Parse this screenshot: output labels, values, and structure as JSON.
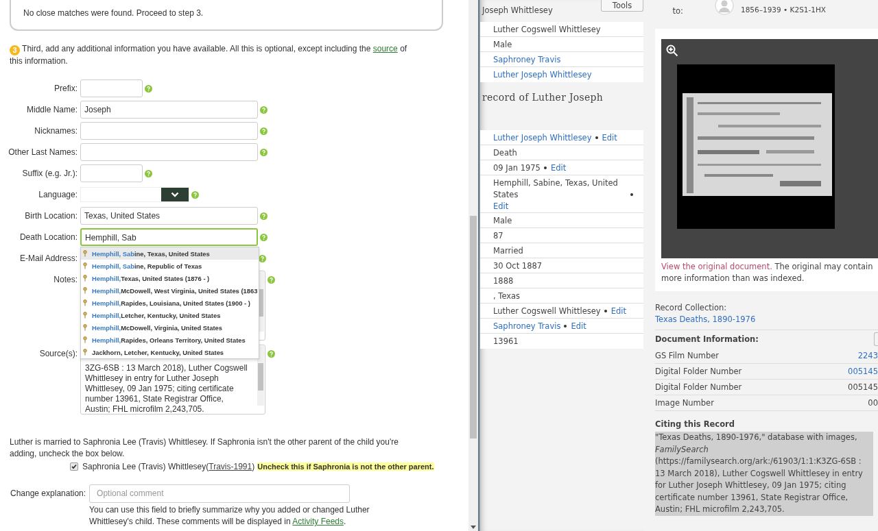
{
  "form": {
    "match_notice": "No close matches were found. Proceed to step 3.",
    "step": {
      "number": "3",
      "before": "Third, add any additional information you have available. All this is optional, except including the",
      "link": "source",
      "after": "of this information."
    },
    "fields": [
      {
        "label": "Prefix:",
        "kind": "short_text"
      },
      {
        "label": "Middle Name:",
        "kind": "text",
        "value": "Joseph"
      },
      {
        "label": "Nicknames:",
        "kind": "text"
      },
      {
        "label": "Other Last Names:",
        "kind": "text"
      },
      {
        "label": "Suffix (e.g. Jr.):",
        "kind": "short_text"
      },
      {
        "label": "Language:",
        "kind": "select"
      },
      {
        "label": "Birth Location:",
        "kind": "text",
        "value": "Texas, United States"
      },
      {
        "label": "Death Location:",
        "kind": "text",
        "value": "Hemphill, Sab",
        "focused": true
      },
      {
        "label": "E-Mail Address:",
        "kind": "covered"
      },
      {
        "label": "Notes:",
        "kind": "textarea"
      },
      {
        "label": "Source(s):",
        "kind": "textarea",
        "value": "3ZG-6SB : 13 March 2018), Luther Cogswell Whittlesey in entry for Luther Joseph Whittlesey, 09 Jan 1975; citing certificate number 13961, State Registrar Office, Austin; FHL microfilm 2,243,705."
      }
    ],
    "suggestions": [
      {
        "match": "Hemphill, Sab",
        "rest": "ine, Texas, United States",
        "selected": true
      },
      {
        "match": "Hemphill, Sab",
        "rest": "ine, Republic of Texas",
        "selected": false
      },
      {
        "match": "Hemphill,",
        "rest": "Texas, United States (1876 - )",
        "selected": false
      },
      {
        "match": "Hemphill,",
        "rest": "McDowell, West Virginia, United States (1863",
        "selected": false
      },
      {
        "match": "Hemphill,",
        "rest": "Rapides, Louisiana, United States (1900 - )",
        "selected": false
      },
      {
        "match": "Hemphill,",
        "rest": "Letcher, Kentucky, United States",
        "selected": false
      },
      {
        "match": "Hemphill,",
        "rest": "McDowell, Virginia, United States",
        "selected": false
      },
      {
        "match": "Hemphill,",
        "rest": "Rapides, Orleans Territory, United States",
        "selected": false
      },
      {
        "rest": "Jackhorn, Letcher, Kentucky, United States",
        "selected": false
      }
    ],
    "spouse_note": "Luther is married to Saphronia Lee (Travis) Whittlesey. If Saphronia isn't the other parent of the child you're adding, uncheck the box below.",
    "spouse_option": {
      "checked": true,
      "name": "Saphronia Lee (Travis) Whittlesey(",
      "id": "Travis-1991",
      "after": ")",
      "warning": "Uncheck this if Saphronia is not the other parent."
    },
    "change_explanation": {
      "label": "Change explanation:",
      "placeholder": "Optional comment",
      "help_before": "You can use this field to briefly summarize why you added or changed Luther Whittlesey's child. These comments will be displayed in",
      "help_link": "Activity Feeds",
      "help_after": "."
    }
  },
  "record": {
    "header_name": "Joseph Whittlesey",
    "tools_button": "Tools",
    "top_rows": [
      {
        "text": "Luther Cogswell Whittlesey",
        "link": false
      },
      {
        "text": "Male",
        "link": false
      },
      {
        "text": "Saphroney Travis",
        "link": true
      },
      {
        "text": "Luther Joseph Whittlesey",
        "link": true
      }
    ],
    "section_title": "record of Luther Joseph",
    "rows": [
      {
        "text": "Luther Joseph Whittlesey",
        "link": true,
        "edit": "Edit"
      },
      {
        "text": "Death",
        "link": false
      },
      {
        "text": "09 Jan 1975",
        "link": false,
        "edit": "Edit"
      },
      {
        "text": "Hemphill, Sabine, Texas, United States",
        "link": false,
        "edit": "Edit"
      },
      {
        "text": "Male",
        "link": false
      },
      {
        "text": "87",
        "link": false
      },
      {
        "text": "Married",
        "link": false
      },
      {
        "text": "30 Oct 1887",
        "link": false
      },
      {
        "text": "1888",
        "link": false
      },
      {
        "text": ", Texas",
        "link": false
      },
      {
        "text": "Luther Cogswell Whittlesey",
        "link": false,
        "edit": "Edit"
      },
      {
        "text": "Saphroney Travis",
        "link": true,
        "edit": "Edit"
      },
      {
        "text": "13961",
        "link": false
      }
    ],
    "attached_label": "to:",
    "attached_meta": "1856–1939 • K2S1-1HX",
    "view_link": "View the original document.",
    "view_note": "The original may contain more information than was indexed.",
    "collection_label": "Record Collection:",
    "collection_link": "Texas Deaths, 1890-1976",
    "doc_title": "Document Information:",
    "doc_rows": [
      {
        "label": "GS Film Number",
        "value": "2243",
        "link": true
      },
      {
        "label": "Digital Folder Number",
        "value": "005145",
        "link": true
      },
      {
        "label": "Digital Folder Number",
        "value": "005145",
        "link": false
      },
      {
        "label": "Image Number",
        "value": "00",
        "link": false
      }
    ],
    "citing_title": "Citing this Record",
    "citation": "\"Texas Deaths, 1890-1976,\" database with images, *FamilySearch* (https://familysearch.org/ark:/61903/1:1:K3ZG-6SB : 13 March 2018), Luther Cogswell Whittlesey in entry for Luther Joseph Whittlesey, 09 Jan 1975; citing certificate number 13961, State Registrar Office, Austin; FHL microfilm 2,243,705."
  }
}
